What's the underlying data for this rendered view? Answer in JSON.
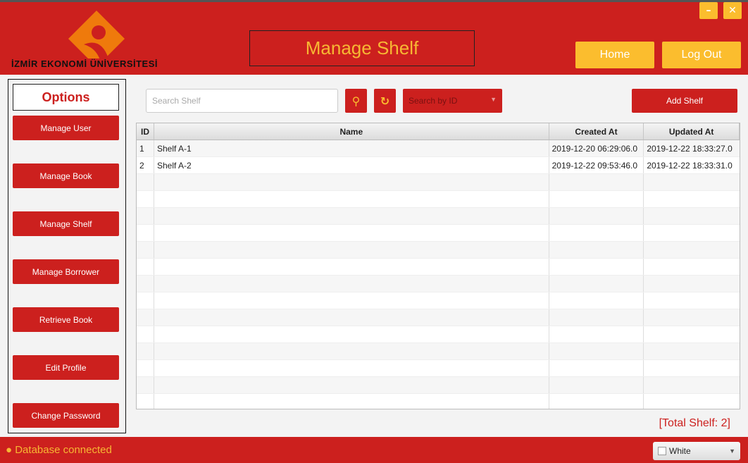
{
  "header": {
    "logo_text": "İZMİR EKONOMİ ÜNİVERSİTESİ",
    "title": "Manage Shelf",
    "home": "Home",
    "logout": "Log Out",
    "minimize": "–",
    "close": "✕"
  },
  "sidebar": {
    "title": "Options",
    "items": [
      {
        "label": "Manage User"
      },
      {
        "label": "Manage Book"
      },
      {
        "label": "Manage Shelf"
      },
      {
        "label": "Manage Borrower"
      },
      {
        "label": "Retrieve Book"
      },
      {
        "label": "Edit Profile"
      },
      {
        "label": "Change Password"
      }
    ]
  },
  "toolbar": {
    "search_placeholder": "Search Shelf",
    "search_value": "",
    "search_by": "Search by ID",
    "add": "Add Shelf"
  },
  "table": {
    "columns": [
      "ID",
      "Name",
      "Created At",
      "Updated At"
    ],
    "rows": [
      [
        "1",
        "Shelf A-1",
        "2019-12-20 06:29:06.0",
        "2019-12-22 18:33:27.0"
      ],
      [
        "2",
        "Shelf A-2",
        "2019-12-22 09:53:46.0",
        "2019-12-22 18:33:31.0"
      ]
    ]
  },
  "total": "[Total Shelf: 2]",
  "footer": {
    "status": "● Database connected",
    "theme": "White"
  },
  "colors": {
    "primary": "#cc201e",
    "accent": "#fbbd2e"
  }
}
